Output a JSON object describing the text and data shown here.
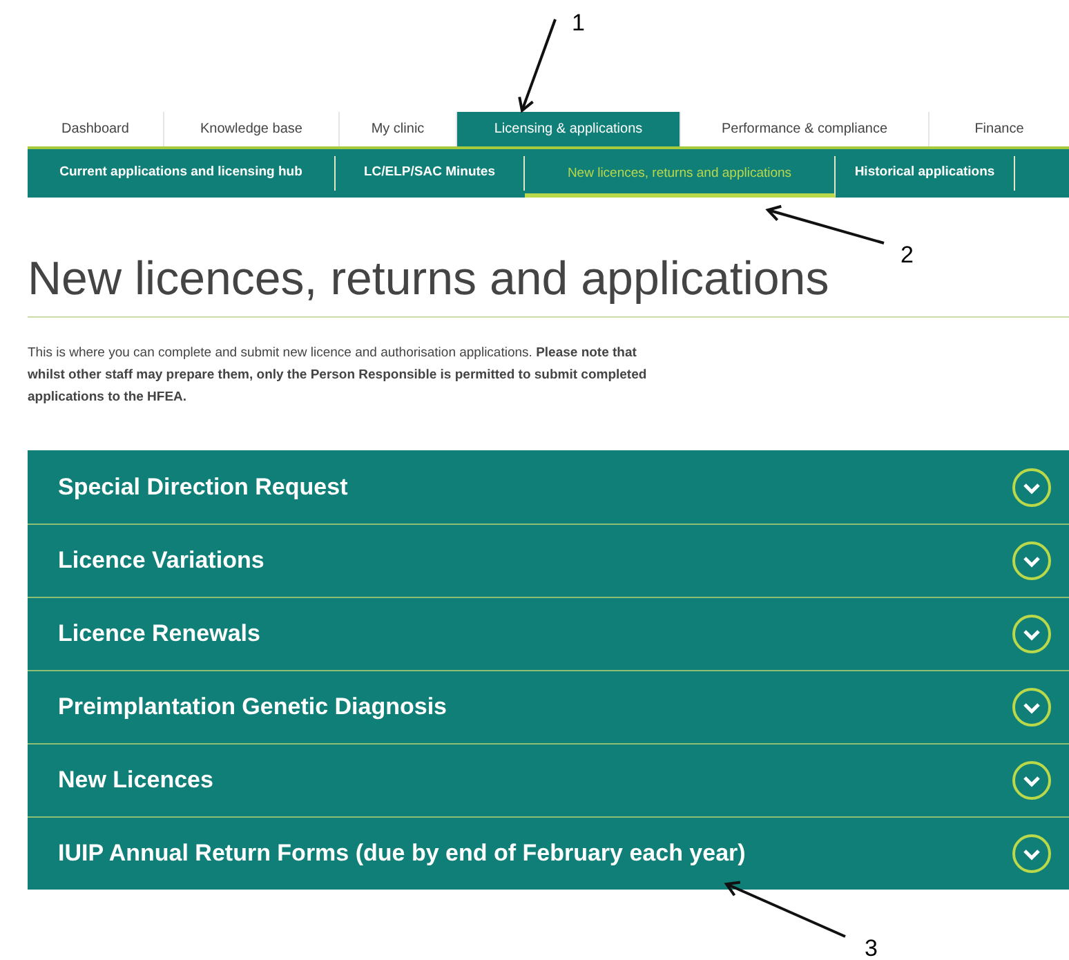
{
  "tabs": [
    {
      "label": "Dashboard",
      "selected": false
    },
    {
      "label": "Knowledge base",
      "selected": false
    },
    {
      "label": "My clinic",
      "selected": false
    },
    {
      "label": "Licensing & applications",
      "selected": true
    },
    {
      "label": "Performance & compliance",
      "selected": false
    },
    {
      "label": "Finance",
      "selected": false
    }
  ],
  "subnav": [
    {
      "label": "Current applications and licensing hub",
      "selected": false
    },
    {
      "label": "LC/ELP/SAC Minutes",
      "selected": false
    },
    {
      "label": "New licences, returns and applications",
      "selected": true
    },
    {
      "label": "Historical applications",
      "selected": false
    }
  ],
  "title": "New licences, returns and applications",
  "intro": "This is where you can complete and submit new licence and authorisation applications. **Please note that whilst other staff may prepare them, only the Person Responsible is permitted to submit completed applications to the HFEA.**",
  "sections": [
    {
      "label": "Special Direction Request",
      "expanded": false
    },
    {
      "label": "Licence Variations",
      "expanded": false
    },
    {
      "label": "Licence Renewals",
      "expanded": false
    },
    {
      "label": "Preimplantation Genetic Diagnosis",
      "expanded": false
    },
    {
      "label": "New Licences",
      "expanded": false
    },
    {
      "label": "IUIP Annual Return Forms (due by end of February each year)",
      "expanded": false
    }
  ],
  "annotations": [
    "1",
    "2",
    "3"
  ]
}
